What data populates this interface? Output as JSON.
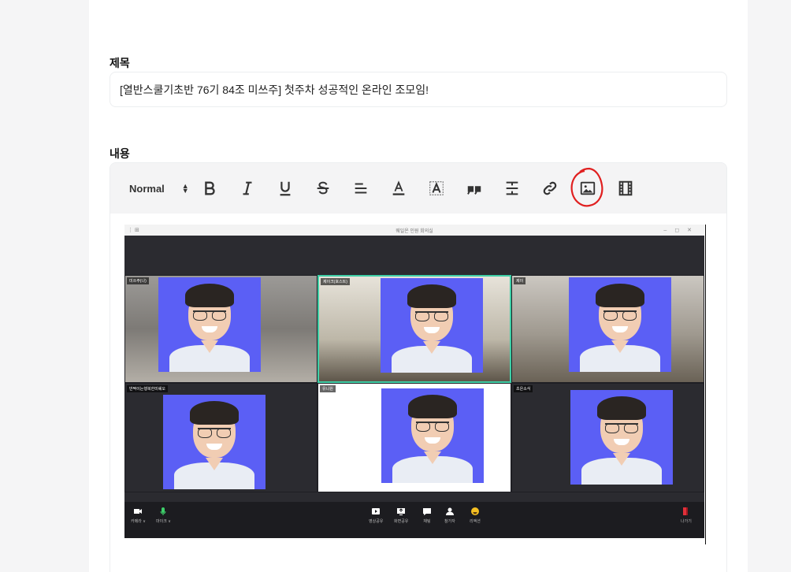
{
  "form": {
    "title_label": "제목",
    "title_value": "[열반스쿨기초반 76기 84조 미쓰주] 첫주차 성공적인 온라인 조모임!",
    "content_label": "내용"
  },
  "toolbar": {
    "format_select": "Normal",
    "buttons": [
      "bold-icon",
      "italic-icon",
      "underline-icon",
      "strike-icon",
      "align-icon",
      "font-color-icon",
      "background-color-icon",
      "blockquote-icon",
      "divider-icon",
      "link-icon",
      "image-icon",
      "video-icon"
    ],
    "highlight_color": "#e02020"
  },
  "meeting": {
    "window_title": "웨일온 인원 회의실",
    "participants": [
      {
        "name": "미쓰주(나)"
      },
      {
        "name": "제이크(호스트)"
      },
      {
        "name": "제이"
      },
      {
        "name": "반짝이는행복한미쉐오"
      },
      {
        "name": "유니원"
      },
      {
        "name": "초은소식"
      }
    ],
    "bottom_left": [
      "카메라 ∨",
      "마이크 ∨"
    ],
    "bottom_center": [
      "영상공유",
      "화면공유",
      "채팅",
      "참가자",
      "리액션"
    ],
    "bottom_right": "나가기"
  },
  "colors": {
    "accent_active_tile": "#3ecfa6",
    "photo_background": "#5b5ff5"
  }
}
